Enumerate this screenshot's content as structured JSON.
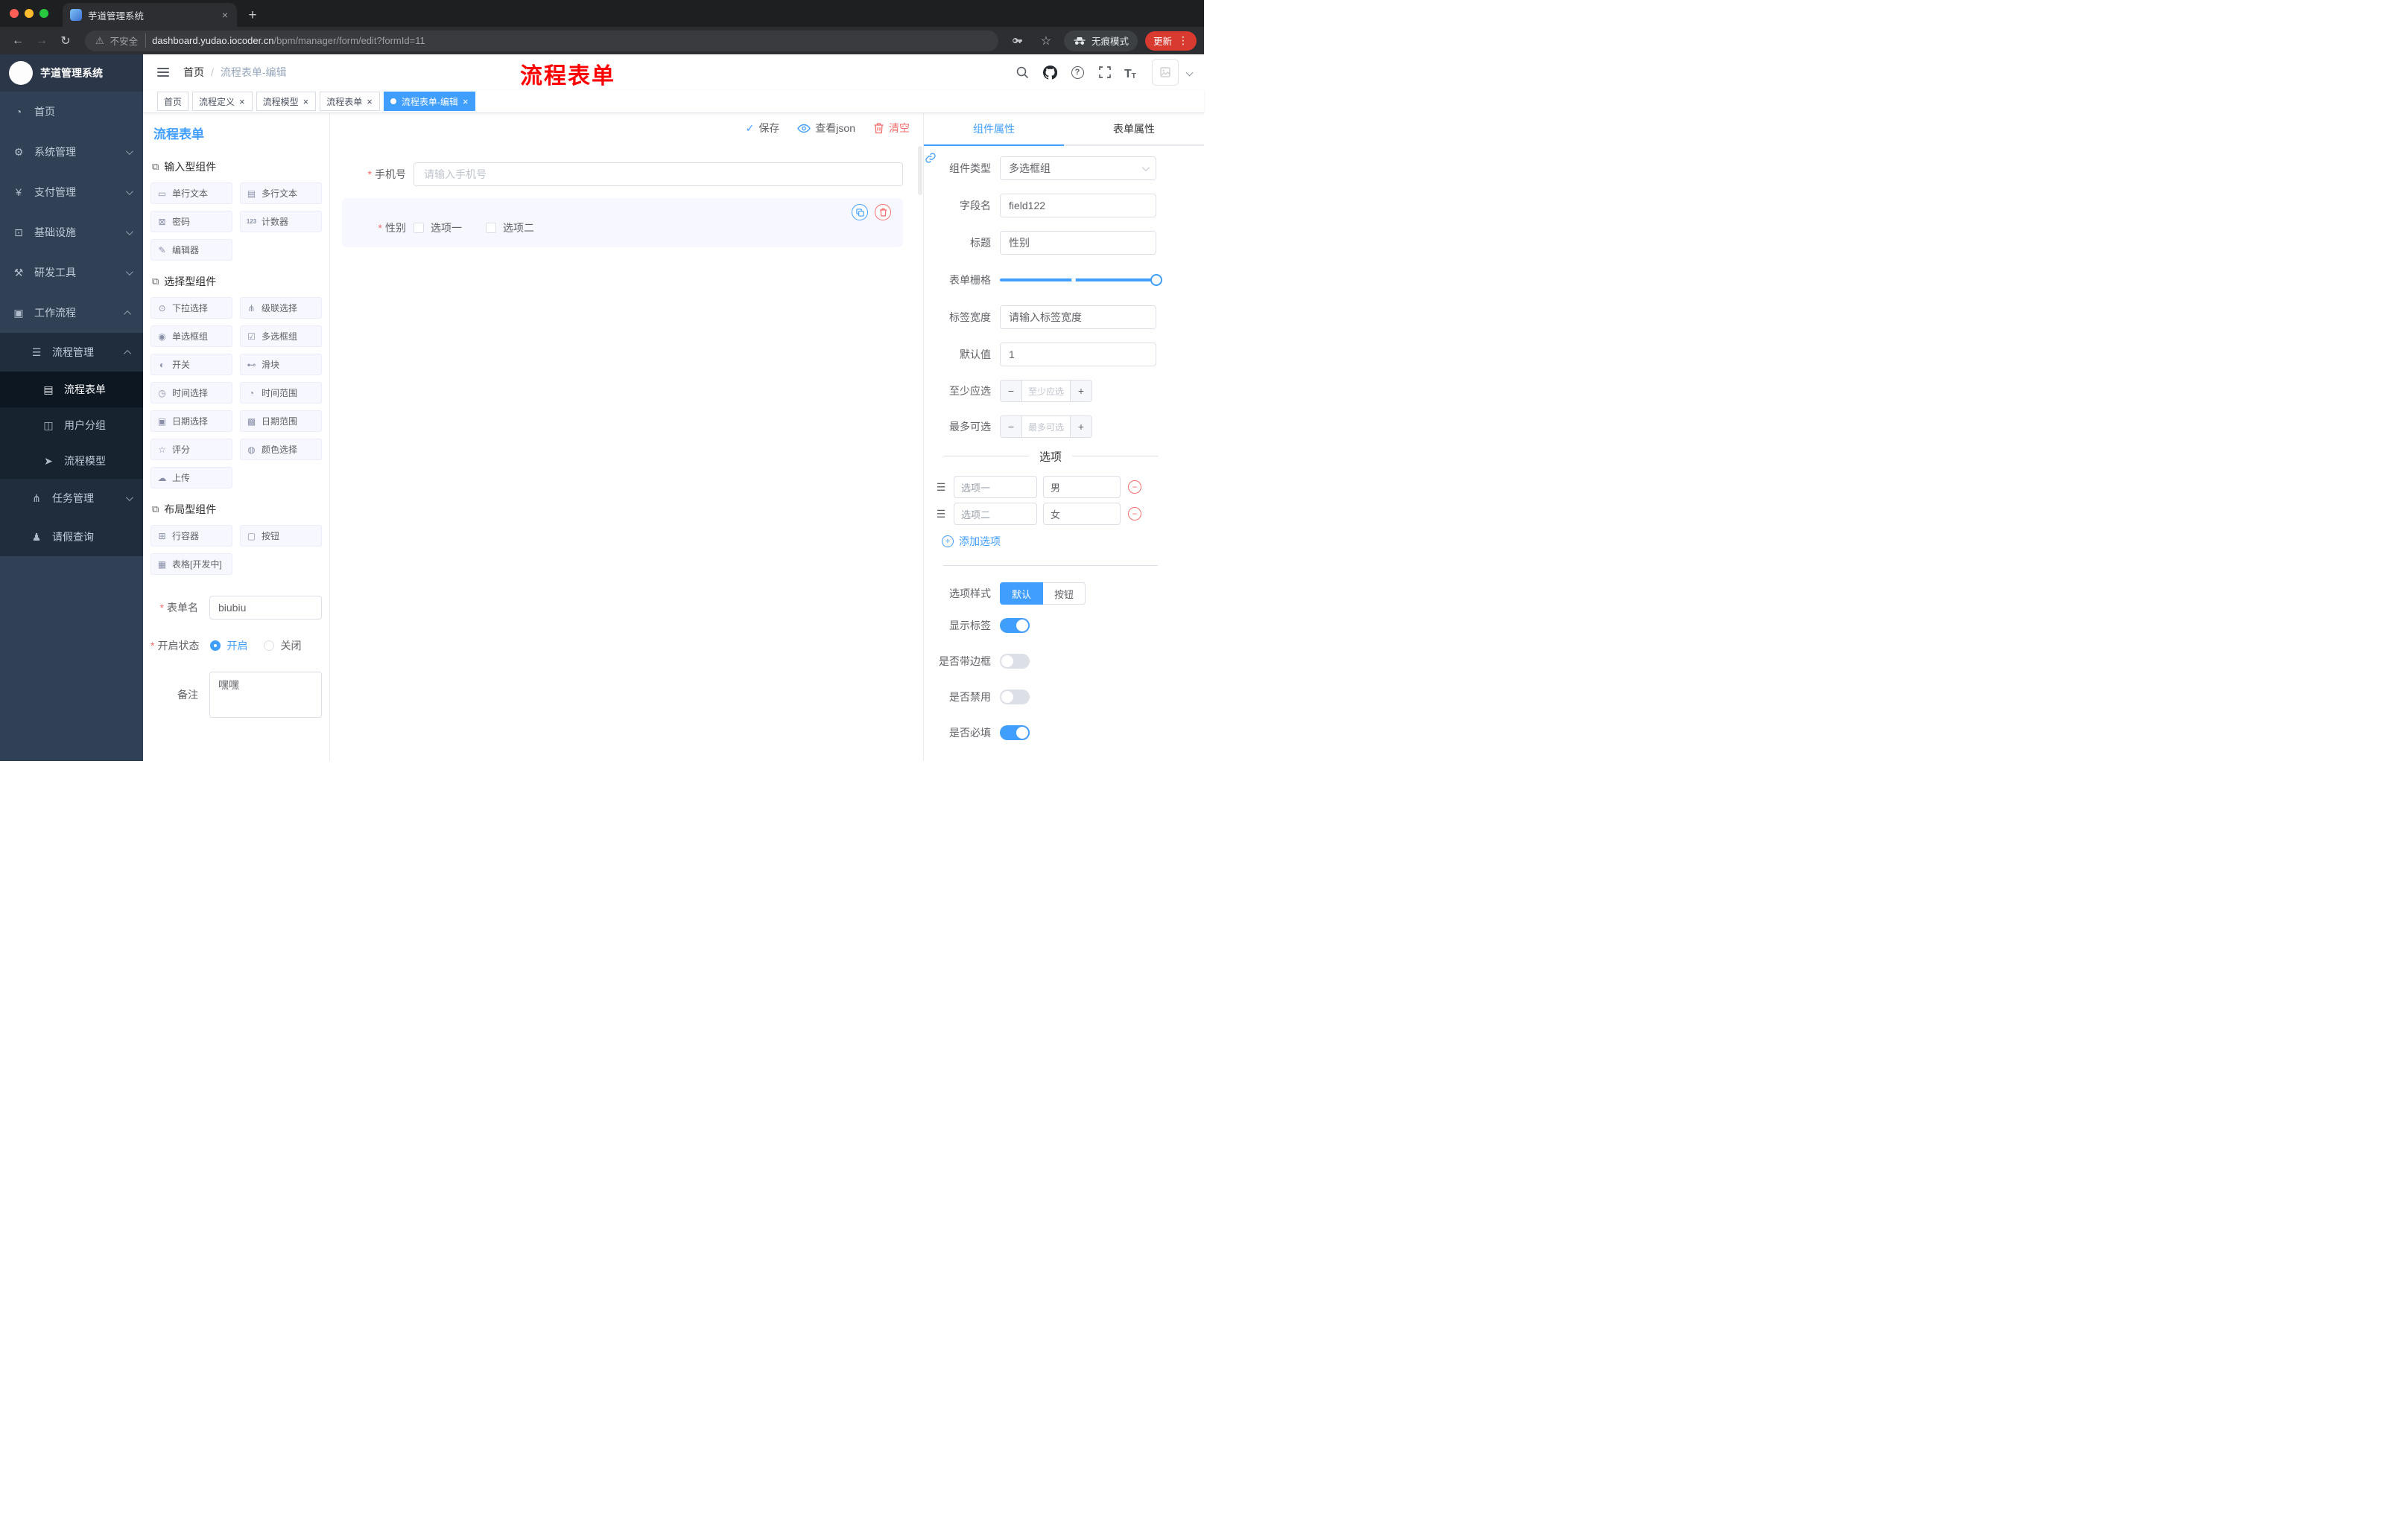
{
  "colors": {
    "accent": "#409EFF",
    "danger": "#F56C6C",
    "annotation_red": "#FF0000",
    "sidebar_bg": "#304156",
    "sidebar_sub_bg": "#1F2D3D",
    "chrome_dark": "#202124"
  },
  "icons": {
    "back": "←",
    "forward": "→",
    "reload": "↻",
    "warning": "⚠",
    "star": "☆",
    "plus": "+",
    "close": "×",
    "menu_dots": "⋮",
    "question": "?",
    "font_large": "T",
    "font_small": "T",
    "check": "✓",
    "minus": "−",
    "add": "+",
    "dashboard": "◔",
    "gear": "⚙",
    "yen": "¥",
    "monitor": "⊡",
    "tools": "⚒",
    "briefcase": "▣",
    "list": "☰",
    "document": "▤",
    "users": "◫",
    "send": "➤",
    "tree": "⋔",
    "person": "♟",
    "section": "⧉",
    "input": "▭",
    "textarea": "▤",
    "lock": "⊠",
    "counter": "123",
    "editor": "✎",
    "select": "⊙",
    "cascader": "⋔",
    "radio": "◉",
    "checkbox": "☑",
    "switch": "◐",
    "slider": "⊷",
    "time": "◷",
    "time_range": "◔",
    "date": "▣",
    "date_range": "▩",
    "rate": "☆",
    "color": "◍",
    "upload": "☁",
    "row": "⊞",
    "button": "▢",
    "table": "▦",
    "handle": "☰"
  },
  "browser": {
    "tab_title": "芋道管理系统",
    "not_secure": "不安全",
    "url_domain": "dashboard.yudao.iocoder.cn",
    "url_path": "/bpm/manager/form/edit?formId=11",
    "incognito": "无痕模式",
    "update": "更新"
  },
  "sidebar": {
    "app_title": "芋道管理系统",
    "items": [
      "首页",
      "系统管理",
      "支付管理",
      "基础设施",
      "研发工具",
      "工作流程",
      "流程管理",
      "流程表单",
      "用户分组",
      "流程模型",
      "任务管理",
      "请假查询"
    ]
  },
  "header": {
    "breadcrumb_home": "首页",
    "breadcrumb_sep": "/",
    "breadcrumb_current": "流程表单-编辑",
    "annotation": "流程表单"
  },
  "tags": [
    "首页",
    "流程定义",
    "流程模型",
    "流程表单",
    "流程表单-编辑"
  ],
  "palette": {
    "title": "流程表单",
    "section_input": "输入型组件",
    "section_select": "选择型组件",
    "section_layout": "布局型组件",
    "items_input": [
      "单行文本",
      "多行文本",
      "密码",
      "计数器",
      "编辑器"
    ],
    "items_select": [
      "下拉选择",
      "级联选择",
      "单选框组",
      "多选框组",
      "开关",
      "滑块",
      "时间选择",
      "时间范围",
      "日期选择",
      "日期范围",
      "评分",
      "颜色选择",
      "上传"
    ],
    "items_layout": [
      "行容器",
      "按钮",
      "表格[开发中]"
    ]
  },
  "form_meta": {
    "name_label": "表单名",
    "name_value": "biubiu",
    "status_label": "开启状态",
    "status_on": "开启",
    "status_off": "关闭",
    "remark_label": "备注",
    "remark_value": "嘿嘿"
  },
  "canvas": {
    "save": "保存",
    "view_json": "查看json",
    "clear": "清空",
    "phone_label": "手机号",
    "phone_placeholder": "请输入手机号",
    "gender_label": "性别",
    "gender_option1": "选项一",
    "gender_option2": "选项二"
  },
  "props": {
    "tab_component": "组件属性",
    "tab_form": "表单属性",
    "component_type_label": "组件类型",
    "component_type_value": "多选框组",
    "field_name_label": "字段名",
    "field_name_value": "field122",
    "title_label": "标题",
    "title_value": "性别",
    "grid_label": "表单栅格",
    "label_width_label": "标签宽度",
    "label_width_placeholder": "请输入标签宽度",
    "default_label": "默认值",
    "default_value": "1",
    "min_label": "至少应选",
    "min_placeholder": "至少应选",
    "max_label": "最多可选",
    "max_placeholder": "最多可选",
    "options_title": "选项",
    "option1_name": "选项一",
    "option1_value": "男",
    "option2_name": "选项二",
    "option2_value": "女",
    "add_option": "添加选项",
    "style_label": "选项样式",
    "style_default": "默认",
    "style_button": "按钮",
    "show_label": "显示标签",
    "border_label": "是否带边框",
    "disabled_label": "是否禁用",
    "required_label": "是否必填"
  }
}
